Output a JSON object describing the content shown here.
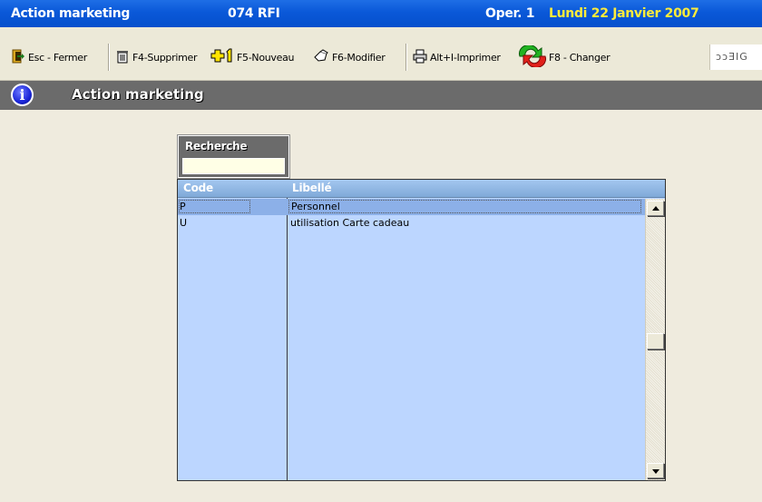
{
  "titlebar": {
    "app": "Action marketing",
    "store": "074 RFI",
    "oper": "Oper. 1",
    "date": "Lundi 22 Janvier 2007"
  },
  "toolbar": {
    "close": "Esc - Fermer",
    "delete": "F4-Supprimer",
    "new": "F5-Nouveau",
    "edit": "F6-Modifier",
    "print": "Alt+I-Imprimer",
    "change": "F8 - Changer",
    "logo": "ɔɔƎIG"
  },
  "header": {
    "title": "Action marketing"
  },
  "search": {
    "label": "Recherche",
    "value": ""
  },
  "grid": {
    "columns": [
      "Code",
      "Libellé"
    ],
    "rows": [
      {
        "code": "P",
        "label": "Personnel",
        "selected": true
      },
      {
        "code": "U",
        "label": "utilisation Carte cadeau",
        "selected": false
      }
    ]
  },
  "colors": {
    "titlebar": "#0a58d8",
    "date": "#ffec3a",
    "header": "#6b6b6b",
    "grid_bg": "#bcd6ff",
    "grid_selected": "#8cb0e8"
  }
}
